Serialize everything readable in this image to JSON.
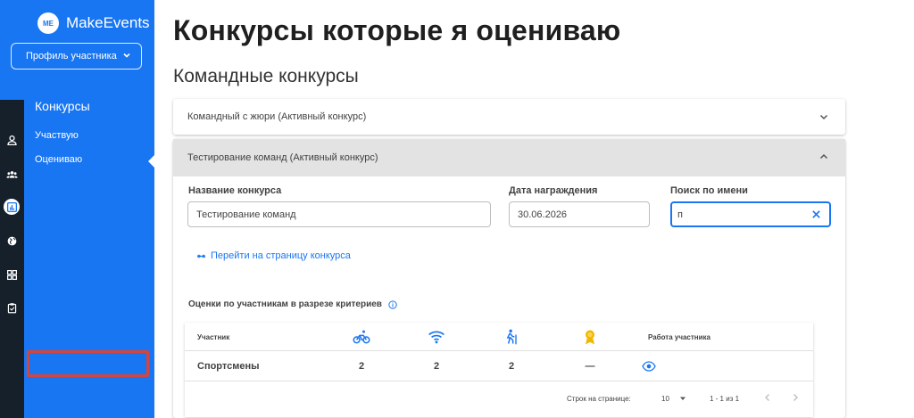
{
  "app": {
    "logo_badge": "ME",
    "name": "MakeEvents",
    "profile_button": "Профиль участника"
  },
  "sidebar": {
    "section_title": "Конкурсы",
    "items": [
      {
        "label": "Участвую"
      },
      {
        "label": "Оцениваю"
      }
    ]
  },
  "rail_icons": [
    "person-icon",
    "group-icon",
    "chart-icon",
    "globe-icon",
    "grid-icon",
    "clipboard-icon"
  ],
  "main": {
    "page_title": "Конкурсы которые я оцениваю",
    "section_title": "Командные конкурсы",
    "accordions": [
      {
        "title": "Командный с жюри (Активный конкурс)",
        "expanded": false
      },
      {
        "title": "Тестирование команд (Активный конкурс)",
        "expanded": true
      }
    ],
    "fields": {
      "name_label": "Название конкурса",
      "name_value": "Тестирование команд",
      "date_label": "Дата награждения",
      "date_value": "30.06.2026",
      "search_label": "Поиск по имени",
      "search_value": "п"
    },
    "link_text": "Перейти на страницу конкурса",
    "scores_title": "Оценки по участникам в разрезе критериев"
  },
  "table": {
    "participant_header": "Участник",
    "criteria_icons": [
      "bike-icon",
      "wifi-icon",
      "hiking-icon",
      "award-icon"
    ],
    "work_header": "Работа участника",
    "rows": [
      {
        "name": "Спортсмены",
        "scores": [
          "2",
          "2",
          "2",
          "—"
        ],
        "work_icon": "eye-icon"
      }
    ],
    "pagination": {
      "rows_per_page_label": "Строк на странице:",
      "rows_per_page": "10",
      "range": "1 - 1 из 1"
    }
  },
  "colors": {
    "primary": "#1976f2",
    "rail": "#15202b",
    "highlight_border": "#d3453d",
    "accordion_active_bg": "#e3e3e3"
  }
}
